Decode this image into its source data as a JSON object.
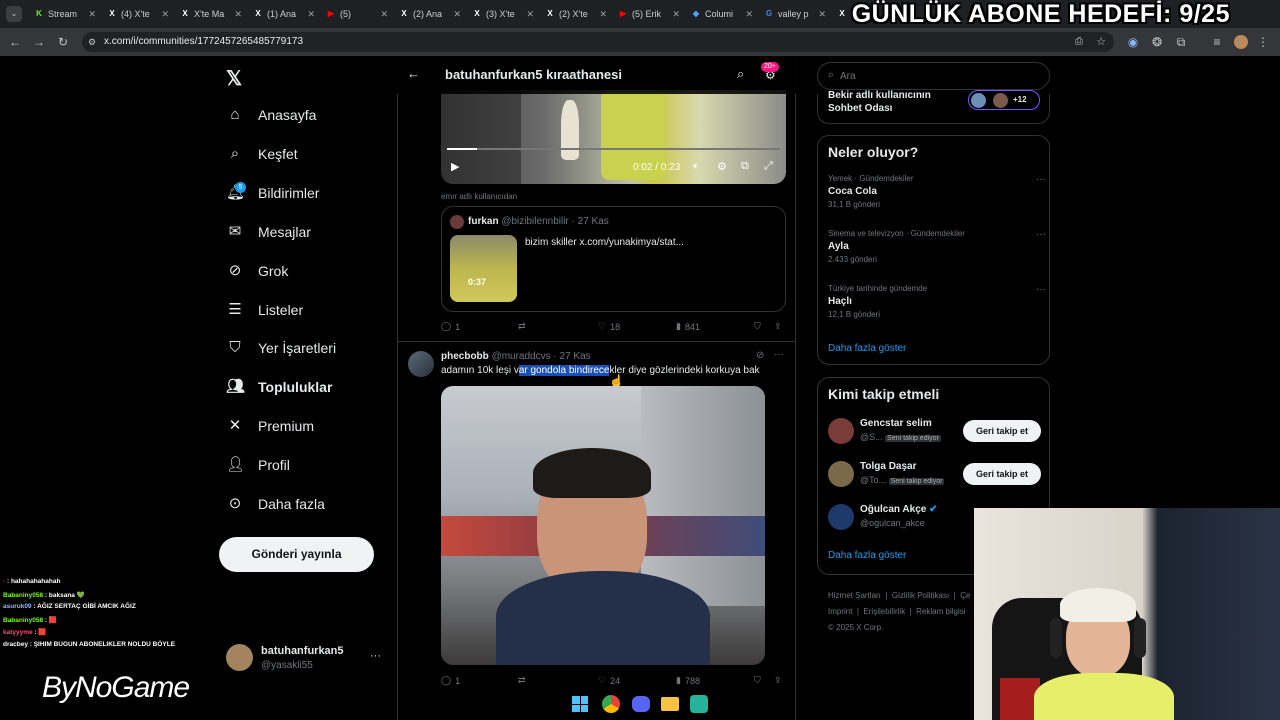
{
  "browser": {
    "tabs": [
      {
        "label": "Stream",
        "fav": "K",
        "color": "#53fc18"
      },
      {
        "label": "(4) X'te",
        "fav": "X",
        "color": "#fff"
      },
      {
        "label": "X'te Ma",
        "fav": "X",
        "color": "#fff"
      },
      {
        "label": "(1) Ana",
        "fav": "X",
        "color": "#fff"
      },
      {
        "label": "(5)",
        "fav": "▶",
        "color": "#ff0000"
      },
      {
        "label": "(2) Ana",
        "fav": "X",
        "color": "#fff"
      },
      {
        "label": "(3) X'te",
        "fav": "X",
        "color": "#fff"
      },
      {
        "label": "(2) X'te",
        "fav": "X",
        "color": "#fff"
      },
      {
        "label": "(5) Erik",
        "fav": "▶",
        "color": "#ff0000"
      },
      {
        "label": "Columi",
        "fav": "◆",
        "color": "#4fa3ff"
      },
      {
        "label": "valley p",
        "fav": "G",
        "color": "#4285f4"
      },
      {
        "label": "(2",
        "fav": "X",
        "color": "#fff"
      }
    ],
    "url": "x.com/i/communities/1772457265485779173"
  },
  "overlay": {
    "goal": "GÜNLÜK ABONE HEDEFİ: 9/25",
    "brand": "ByNoGame"
  },
  "nav": {
    "items": [
      {
        "label": "Anasayfa",
        "icon": "home-icon",
        "glyph": "⌂"
      },
      {
        "label": "Keşfet",
        "icon": "search-icon",
        "glyph": "⌕"
      },
      {
        "label": "Bildirimler",
        "icon": "bell-icon",
        "glyph": "🔔︎"
      },
      {
        "label": "Mesajlar",
        "icon": "mail-icon",
        "glyph": "✉"
      },
      {
        "label": "Grok",
        "icon": "grok-icon",
        "glyph": "⊘"
      },
      {
        "label": "Listeler",
        "icon": "list-icon",
        "glyph": "☰"
      },
      {
        "label": "Yer İşaretleri",
        "icon": "bookmark-icon",
        "glyph": "⛉"
      },
      {
        "label": "Topluluklar",
        "icon": "communities-icon",
        "glyph": "👥︎"
      },
      {
        "label": "Premium",
        "icon": "x-premium-icon",
        "glyph": "✕"
      },
      {
        "label": "Profil",
        "icon": "profile-icon",
        "glyph": "👤︎"
      },
      {
        "label": "Daha fazla",
        "icon": "more-circle-icon",
        "glyph": "⊙"
      }
    ],
    "notif_badge": "5",
    "post_button": "Gönderi yayınla",
    "account": {
      "name": "batuhanfurkan5",
      "handle": "@yasakli55"
    }
  },
  "header": {
    "title": "batuhanfurkan5 kıraathanesi",
    "badge": "20+"
  },
  "post1": {
    "video_time": "0:02 / 0:23",
    "reply_context": "emır adlı kullanıcıdan",
    "quote": {
      "name": "furkan",
      "handle": "@bizibilennbilir",
      "date": "27 Kas",
      "text": "bizim skiller  x.com/yunakimya/stat...",
      "duration": "0:37"
    },
    "replies": "1",
    "likes": "18",
    "views": "841"
  },
  "post2": {
    "name": "phecbobb",
    "handle": "@muraddcvs",
    "date": "27 Kas",
    "text_pre": "adamın 10k leşi v",
    "text_sel": "ar gondola bindirece",
    "text_post": "kler diye gözlerindeki korkuya bak",
    "replies": "1",
    "likes": "24",
    "views": "788"
  },
  "search": {
    "placeholder": "Ara"
  },
  "chatroom": {
    "line1": "Bekir adlı kullanıcının",
    "line2": "Sohbet Odası",
    "count": "+12"
  },
  "trends": {
    "title": "Neler oluyor?",
    "items": [
      {
        "context": "Yemek · Gündemdekiler",
        "name": "Coca Cola",
        "posts": "31,1 B gönderi"
      },
      {
        "context": "Sinema ve televizyon · Gündemdekiler",
        "name": "Ayla",
        "posts": "2.433 gönderi"
      },
      {
        "context": "Türkiye tarihinde gündemde",
        "name": "Haçlı",
        "posts": "12,1 B gönderi"
      }
    ],
    "more": "Daha fazla göster"
  },
  "who": {
    "title": "Kimi takip etmeli",
    "items": [
      {
        "name": "Gencstar selim",
        "handle": "@S...",
        "tag": "Seni takip ediyor",
        "button": "Geri takip et"
      },
      {
        "name": "Tolga Daşar",
        "handle": "@To...",
        "tag": "Seni takip ediyor",
        "button": "Geri takip et"
      },
      {
        "name": "Oğulcan Akçe",
        "handle": "@ogulcan_akce",
        "tag": "",
        "button": ""
      }
    ],
    "more": "Daha fazla göster"
  },
  "footer": {
    "links": [
      "Hizmet Şartları",
      "Gizlilik Politikası",
      "Çe",
      "Imprint",
      "Erişilebilirlik",
      "Reklam bilgisi"
    ],
    "copyright": "© 2025 X Corp."
  },
  "chat": [
    {
      "user": "·",
      "msg": ": hahahahahahah",
      "ucolor": "#ff4444"
    },
    {
      "user": "Babaniny058",
      "msg": ": baksana 💚",
      "ucolor": "#7cfc00"
    },
    {
      "user": "asuruk09",
      "msg": ": AĞIZ SERTAÇ GİBİ AMCIK AĞIZ",
      "ucolor": "#9ab7ff"
    },
    {
      "user": "Babaniny058",
      "msg": ": 🟥",
      "ucolor": "#7cfc00"
    },
    {
      "user": "katyyyme",
      "msg": ": 🟥",
      "ucolor": "#ff4a6e"
    },
    {
      "user": "dracbey",
      "msg": ": ŞIHIM BUGUN ABONELIKLER NOLDU BÖYLE",
      "ucolor": "#ffffff"
    }
  ]
}
